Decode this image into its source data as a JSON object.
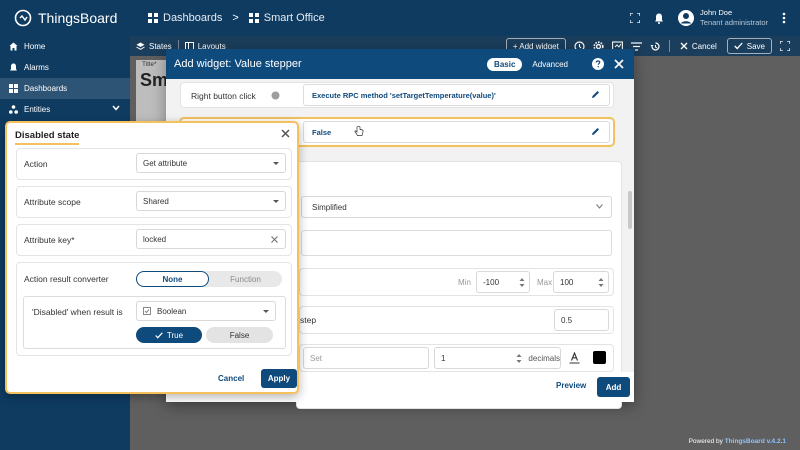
{
  "app": {
    "logo_text": "ThingsBoard",
    "breadcrumb": [
      "Dashboards",
      "Smart Office"
    ],
    "user": {
      "name": "John Doe",
      "role": "Tenant administrator"
    }
  },
  "sidebar": {
    "items": [
      {
        "label": "Home",
        "icon": "home-icon",
        "active": false
      },
      {
        "label": "Alarms",
        "icon": "alarm-icon",
        "active": false
      },
      {
        "label": "Dashboards",
        "icon": "dashboards-icon",
        "active": true
      },
      {
        "label": "Entities",
        "icon": "entities-icon",
        "active": false,
        "expandable": true
      }
    ]
  },
  "toolbar": {
    "states_label": "States",
    "layouts_label": "Layouts",
    "add_widget_label": "+ Add widget",
    "cancel_label": "Cancel",
    "save_label": "Save"
  },
  "page": {
    "title_small": "Title*",
    "title_big": "Sm",
    "powered_prefix": "Powered by",
    "powered_brand": "ThingsBoard v.4.2.1"
  },
  "dialog": {
    "title": "Add widget:  Value stepper",
    "mode_basic": "Basic",
    "mode_advanced": "Advanced",
    "right_button_click_label": "Right button click",
    "right_button_click_value": "Execute RPC method 'setTargetTemperature(value)'",
    "disabled_state_value": "False",
    "appearance_select_value": "Simplified",
    "min_label": "Min",
    "min_value": "-100",
    "max_label": "Max",
    "max_value": "100",
    "step_label": "step",
    "step_value": "0.5",
    "set_placeholder": "Set",
    "decimals_value": "1",
    "decimals_label": "decimals",
    "text_color": "#000000",
    "preview_label": "Preview",
    "add_label": "Add"
  },
  "panel": {
    "title": "Disabled state",
    "action_label": "Action",
    "action_value": "Get attribute",
    "scope_label": "Attribute scope",
    "scope_value": "Shared",
    "key_label": "Attribute key*",
    "key_value": "locked",
    "converter_label": "Action result converter",
    "converter_none": "None",
    "converter_function": "Function",
    "result_label": "'Disabled' when result is",
    "result_type": "Boolean",
    "true_label": "True",
    "false_label": "False",
    "cancel_label": "Cancel",
    "apply_label": "Apply"
  },
  "colors": {
    "brand_dark": "#0f3b61",
    "primary": "#0f4a7d",
    "highlight": "#f5c15d"
  }
}
